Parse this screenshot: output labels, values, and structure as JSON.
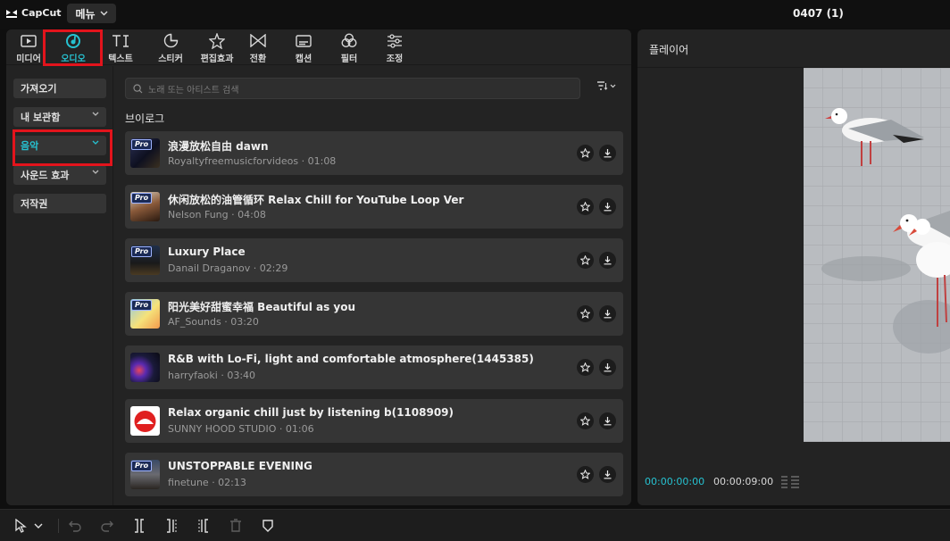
{
  "app": {
    "name": "CapCut",
    "menu_label": "메뉴",
    "project_title": "0407 (1)"
  },
  "toolbar": {
    "tabs": [
      {
        "label": "미디어",
        "icon": "media-icon"
      },
      {
        "label": "오디오",
        "icon": "audio-icon",
        "active": true
      },
      {
        "label": "텍스트",
        "icon": "text-icon"
      },
      {
        "label": "스티커",
        "icon": "sticker-icon"
      },
      {
        "label": "편집효과",
        "icon": "effects-icon"
      },
      {
        "label": "전환",
        "icon": "transition-icon"
      },
      {
        "label": "캡션",
        "icon": "caption-icon"
      },
      {
        "label": "필터",
        "icon": "filter-icon"
      },
      {
        "label": "조정",
        "icon": "adjust-icon"
      }
    ]
  },
  "sidebar": {
    "items": [
      {
        "label": "가져오기"
      },
      {
        "label": "내 보관함"
      },
      {
        "label": "음악",
        "active": true
      },
      {
        "label": "사운드 효과"
      },
      {
        "label": "저작권"
      }
    ]
  },
  "library": {
    "search_placeholder": "노래 또는 아티스트 검색",
    "section_title": "브이로그",
    "pro_label": "Pro",
    "tracks": [
      {
        "title": "浪漫放松自由  dawn",
        "meta": "Royaltyfreemusicforvideos · 01:08",
        "pro": true
      },
      {
        "title": "休闲放松的油管循环  Relax Chill for YouTube Loop Ver",
        "meta": "Nelson Fung · 04:08",
        "pro": true
      },
      {
        "title": "Luxury Place",
        "meta": "Danail Draganov · 02:29",
        "pro": true
      },
      {
        "title": "阳光美好甜蜜幸福  Beautiful as you",
        "meta": "AF_Sounds · 03:20",
        "pro": true
      },
      {
        "title": "R&B with Lo-Fi, light and comfortable atmosphere(1445385)",
        "meta": "harryfaoki · 03:40",
        "pro": false
      },
      {
        "title": "Relax organic chill just by listening b(1108909)",
        "meta": "SUNNY HOOD STUDIO · 01:06",
        "pro": false
      },
      {
        "title": "UNSTOPPABLE EVENING",
        "meta": "finetune · 02:13",
        "pro": true
      }
    ]
  },
  "player": {
    "title": "플레이어",
    "current_time": "00:00:00:00",
    "total_time": "00:00:09:00"
  },
  "colors": {
    "accent": "#26c2d1",
    "highlight": "#e3141c",
    "panel": "#232323",
    "card": "#353535"
  }
}
